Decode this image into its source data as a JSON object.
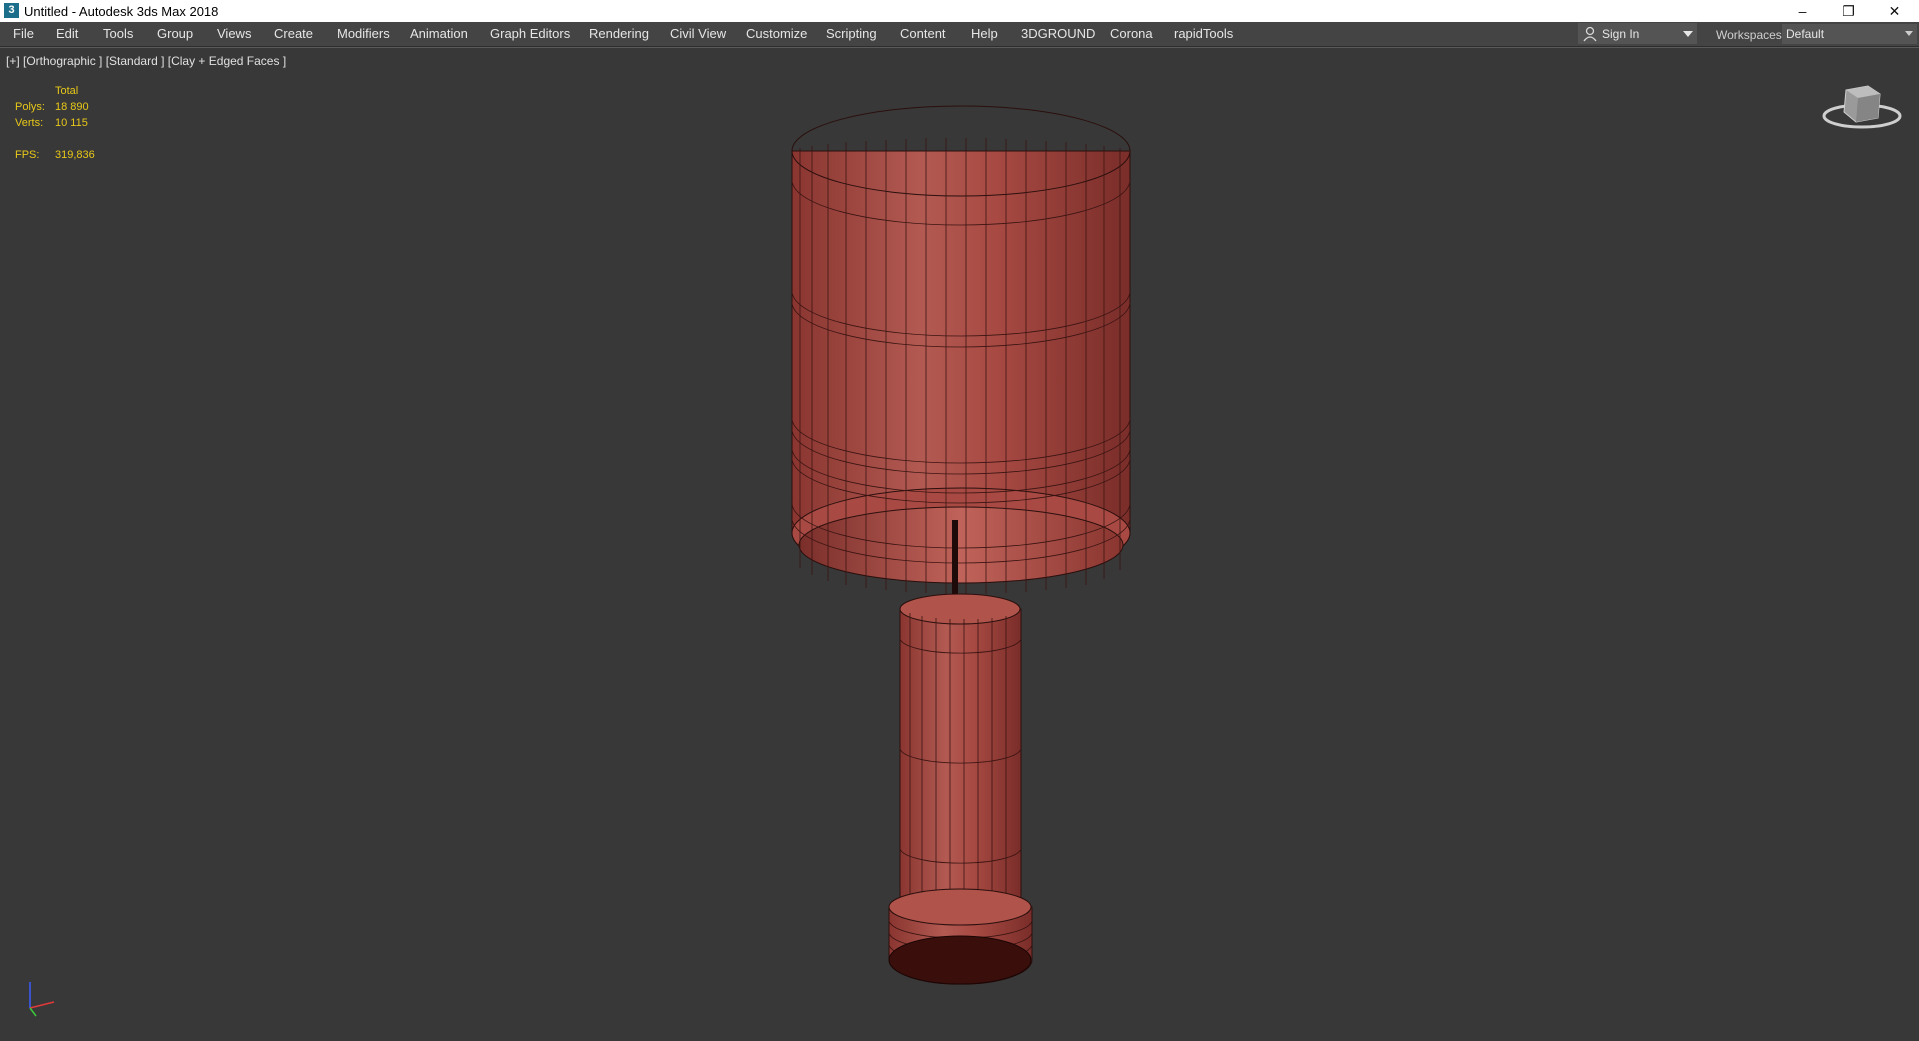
{
  "window": {
    "title": "Untitled - Autodesk 3ds Max 2018",
    "app_icon": "3ds-max-icon",
    "controls": [
      "minimize-icon",
      "restore-icon",
      "close-icon"
    ],
    "minimize_glyph": "–",
    "restore_glyph": "❐",
    "close_glyph": "✕"
  },
  "menubar": {
    "items": [
      "File",
      "Edit",
      "Tools",
      "Group",
      "Views",
      "Create",
      "Modifiers",
      "Animation",
      "Graph Editors",
      "Rendering",
      "Civil View",
      "Customize",
      "Scripting",
      "Content",
      "Help",
      "3DGROUND",
      "Corona",
      "rapidTools"
    ]
  },
  "account": {
    "sign_in": "Sign In",
    "icon": "user-icon"
  },
  "workspaces": {
    "label": "Workspaces:",
    "value": "Default"
  },
  "viewport": {
    "label": "[+] [Orthographic ] [Standard ] [Clay + Edged Faces ]",
    "stats": {
      "total_label": "Total",
      "polys_label": "Polys:",
      "polys_value": "18 890",
      "verts_label": "Verts:",
      "verts_value": "10 115",
      "fps_label": "FPS:",
      "fps_value": "319,836"
    },
    "background_color": "#383838",
    "model_color": "#a5463f",
    "stats_color": "#e8c818"
  }
}
